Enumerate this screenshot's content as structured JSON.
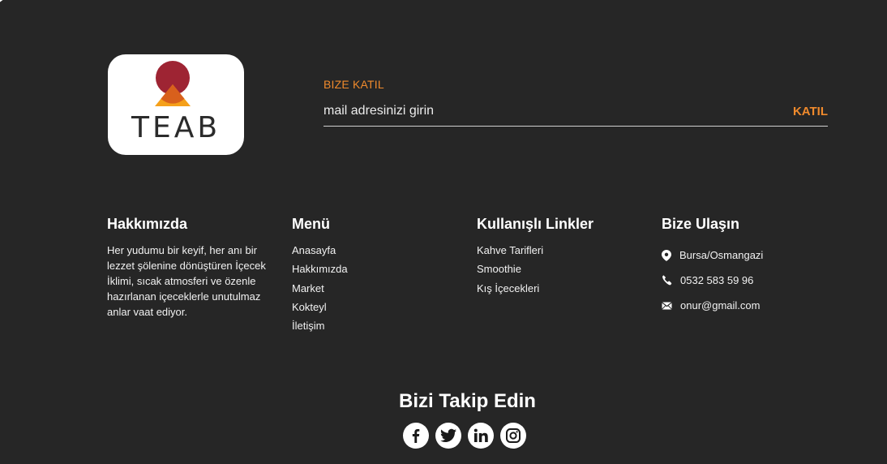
{
  "brand": {
    "logo_text": "TEAB"
  },
  "subscribe": {
    "title": "BIZE KATIL",
    "placeholder": "mail adresinizi girin",
    "button": "KATIL"
  },
  "about": {
    "title": "Hakkımızda",
    "text": "Her yudumu bir keyif, her anı bir lezzet şölenine dönüştüren İçecek İklimi, sıcak atmosferi ve özenle hazırlanan içeceklerle unutulmaz anlar vaat ediyor."
  },
  "menu": {
    "title": "Menü",
    "items": [
      "Anasayfa",
      "Hakkımızda",
      "Market",
      "Kokteyl",
      "İletişim"
    ]
  },
  "links": {
    "title": "Kullanışlı Linkler",
    "items": [
      "Kahve Tarifleri",
      "Smoothie",
      "Kış İçecekleri"
    ]
  },
  "contact": {
    "title": "Bize Ulaşın",
    "location": "Bursa/Osmangazi",
    "phone": "0532 583 59 96",
    "email": "onur@gmail.com"
  },
  "follow": {
    "title": "Bizi Takip Edin",
    "icons": [
      "facebook-icon",
      "twitter-icon",
      "linkedin-icon",
      "instagram-icon"
    ]
  },
  "colors": {
    "background": "#262626",
    "accent": "#f08a2c",
    "logo_red": "#9e2433",
    "logo_orange": "#f5a01a"
  }
}
